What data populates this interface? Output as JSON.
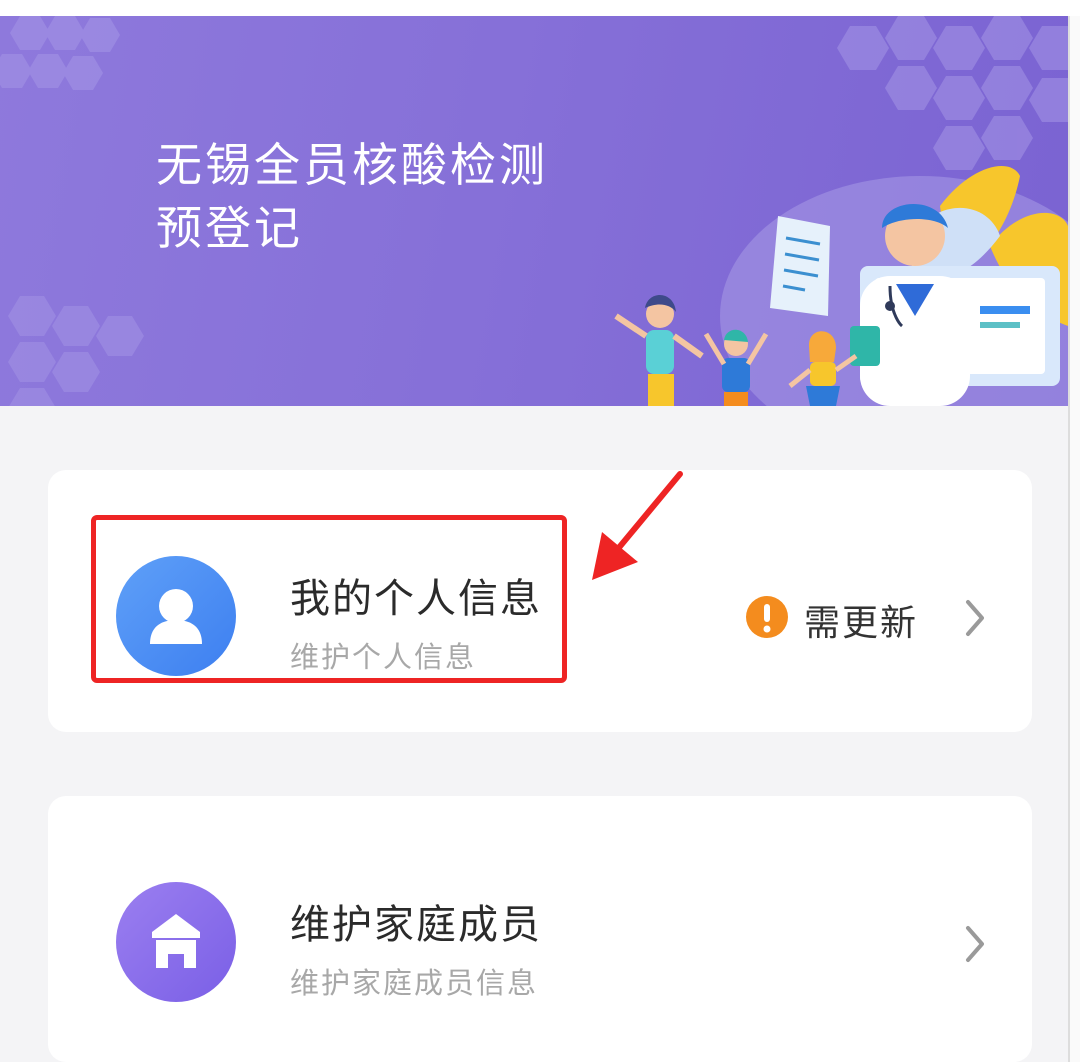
{
  "banner": {
    "title": "无锡全员核酸检测\n预登记"
  },
  "cards": [
    {
      "title": "我的个人信息",
      "subtitle": "维护个人信息",
      "icon": "person-icon",
      "status": {
        "icon": "exclamation-icon",
        "label": "需更新",
        "color": "#f48c1e"
      }
    },
    {
      "title": "维护家庭成员",
      "subtitle": "维护家庭成员信息",
      "icon": "home-icon"
    }
  ],
  "colors": {
    "banner": "#8670d8",
    "avatar_person": "#4a8cf3",
    "avatar_home": "#8a6cea",
    "highlight": "#ee2424",
    "warning": "#f48c1e"
  }
}
